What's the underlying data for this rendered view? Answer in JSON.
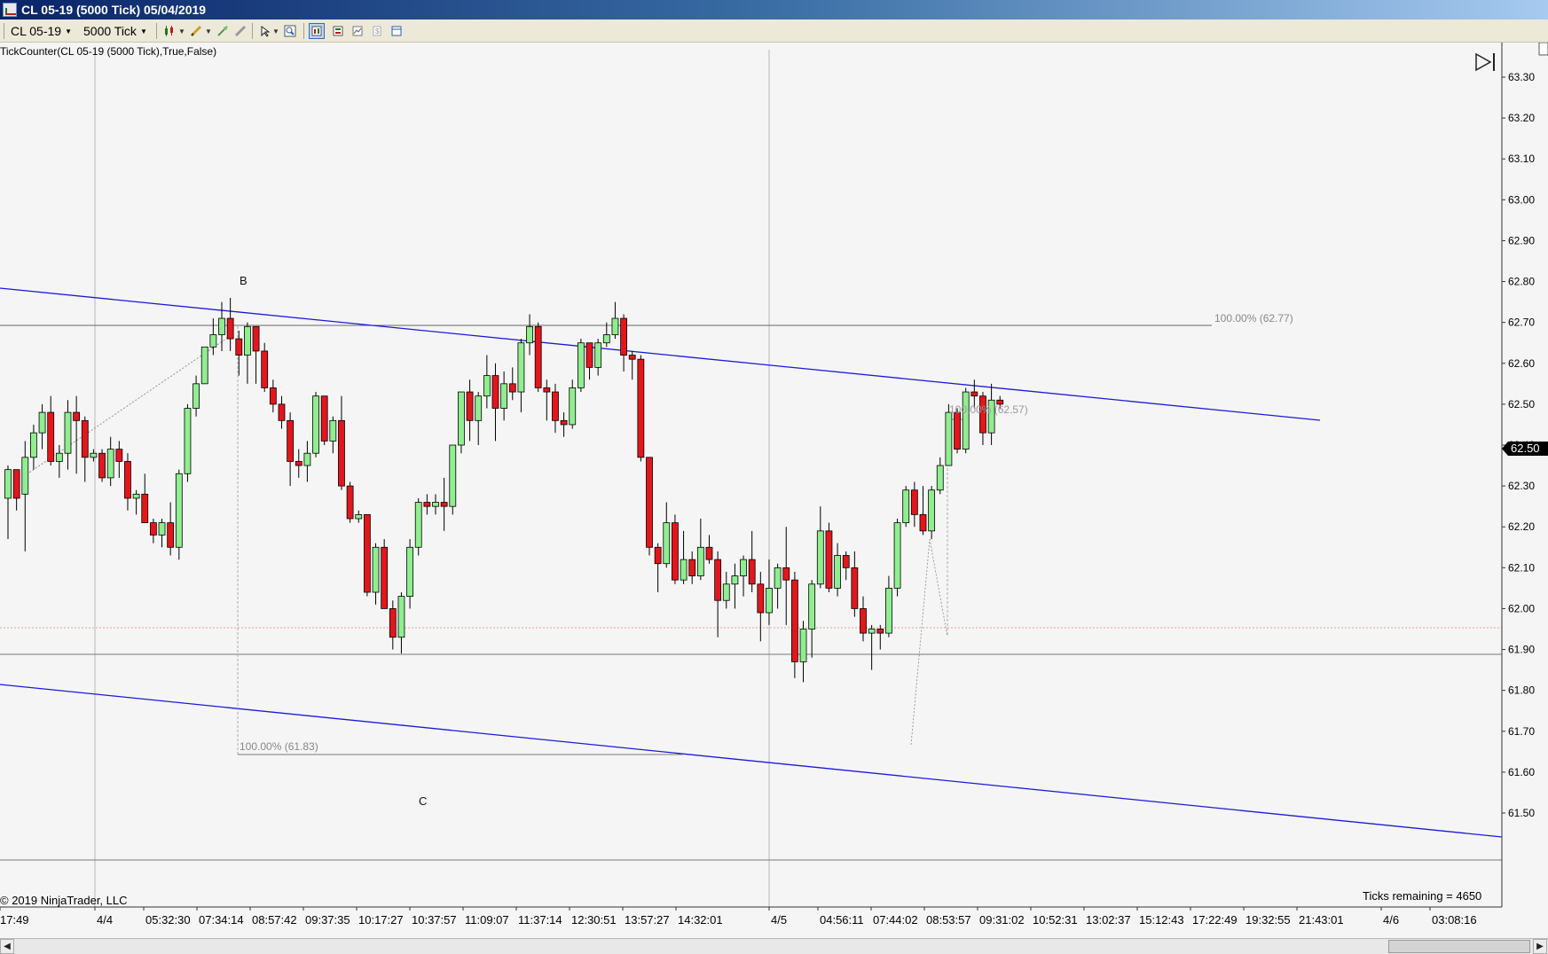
{
  "window": {
    "title": "CL 05-19 (5000 Tick)  05/04/2019"
  },
  "toolbar": {
    "instrument": "CL 05-19",
    "interval": "5000 Tick",
    "icons": [
      "candlestick-icon",
      "pencil-icon",
      "draw-tool-icon",
      "eraser-icon",
      "pointer-icon",
      "zoom-icon",
      "chart-properties-icon",
      "data-box-icon",
      "strategy-icon",
      "alert-icon",
      "window-layout-icon"
    ]
  },
  "chart": {
    "indicator_label": "TickCounter(CL 05-19 (5000 Tick),True,False)",
    "copyright": "© 2019 NinjaTrader, LLC",
    "ticks_remaining": "Ticks remaining = 4650",
    "current_price": "62.50",
    "annotations": {
      "b": "B",
      "c": "C",
      "fib_top": "100.00% (62.77)",
      "fib_mid": "100.00% (62.57)",
      "fib_bottom": "100.00% (61.83)"
    },
    "colors": {
      "up": "#90ee90",
      "down": "#e3161c",
      "channel": "#1a1adb",
      "price_marker": "#000000"
    }
  },
  "chart_data": {
    "type": "candlestick",
    "y_ticks": [
      "63.30",
      "63.20",
      "63.10",
      "63.00",
      "62.90",
      "62.80",
      "62.70",
      "62.60",
      "62.50",
      "62.40",
      "62.30",
      "62.20",
      "62.10",
      "62.00",
      "61.90",
      "61.80",
      "61.70",
      "61.60",
      "61.50"
    ],
    "x_ticks": [
      "17:49",
      "4/4",
      "05:32:30",
      "07:34:14",
      "08:57:42",
      "09:37:35",
      "10:17:27",
      "10:37:57",
      "11:09:07",
      "11:37:14",
      "12:30:51",
      "13:57:27",
      "14:32:01",
      "4/5",
      "04:56:11",
      "07:44:02",
      "08:53:57",
      "09:31:02",
      "10:52:31",
      "13:02:37",
      "15:12:43",
      "17:22:49",
      "19:32:55",
      "21:43:01",
      "4/6",
      "03:08:16"
    ],
    "ylim": [
      61.5,
      63.33
    ],
    "candles": [
      [
        62.27,
        62.34,
        62.17,
        62.35
      ],
      [
        62.34,
        62.27,
        62.28,
        62.24
      ],
      [
        62.28,
        62.37,
        62.41,
        62.14
      ],
      [
        62.37,
        62.43,
        62.45,
        62.34
      ],
      [
        62.43,
        62.48,
        62.5,
        62.39
      ],
      [
        62.48,
        62.36,
        62.52,
        62.35
      ],
      [
        62.36,
        62.38,
        62.4,
        62.32
      ],
      [
        62.38,
        62.48,
        62.51,
        62.34
      ],
      [
        62.48,
        62.46,
        62.52,
        62.33
      ],
      [
        62.46,
        62.37,
        62.47,
        62.31
      ],
      [
        62.37,
        62.38,
        62.39,
        62.36
      ],
      [
        62.38,
        62.32,
        62.39,
        62.31
      ],
      [
        62.32,
        62.39,
        62.42,
        62.3
      ],
      [
        62.39,
        62.36,
        62.41,
        62.32
      ],
      [
        62.36,
        62.27,
        62.38,
        62.24
      ],
      [
        62.27,
        62.28,
        62.29,
        62.23
      ],
      [
        62.28,
        62.21,
        62.33,
        62.21
      ],
      [
        62.21,
        62.18,
        62.22,
        62.16
      ],
      [
        62.18,
        62.21,
        62.22,
        62.15
      ],
      [
        62.21,
        62.15,
        62.26,
        62.13
      ],
      [
        62.15,
        62.33,
        62.34,
        62.12
      ],
      [
        62.33,
        62.49,
        62.5,
        62.31
      ],
      [
        62.49,
        62.55,
        62.57,
        62.47
      ],
      [
        62.55,
        62.64,
        62.64,
        62.55
      ],
      [
        62.64,
        62.67,
        62.71,
        62.62
      ],
      [
        62.67,
        62.71,
        62.75,
        62.63
      ],
      [
        62.71,
        62.66,
        62.76,
        62.63
      ],
      [
        62.66,
        62.62,
        62.68,
        62.57
      ],
      [
        62.62,
        62.69,
        62.7,
        62.55
      ],
      [
        62.69,
        62.63,
        62.68,
        62.55
      ],
      [
        62.63,
        62.54,
        62.65,
        62.53
      ],
      [
        62.54,
        62.5,
        62.56,
        62.48
      ],
      [
        62.5,
        62.46,
        62.52,
        62.44
      ],
      [
        62.46,
        62.36,
        62.48,
        62.3
      ],
      [
        62.36,
        62.35,
        62.39,
        62.32
      ],
      [
        62.35,
        62.38,
        62.41,
        62.31
      ],
      [
        62.38,
        62.52,
        62.53,
        62.37
      ],
      [
        62.52,
        62.41,
        62.52,
        62.4
      ],
      [
        62.41,
        62.46,
        62.47,
        62.38
      ],
      [
        62.46,
        62.3,
        62.52,
        62.29
      ],
      [
        62.3,
        62.22,
        62.31,
        62.21
      ],
      [
        62.22,
        62.23,
        62.24,
        62.21
      ],
      [
        62.23,
        62.04,
        62.23,
        62.03
      ],
      [
        62.04,
        62.15,
        62.16,
        62.01
      ],
      [
        62.15,
        62.0,
        62.17,
        62.0
      ],
      [
        62.0,
        61.93,
        62.02,
        61.9
      ],
      [
        61.93,
        62.03,
        62.04,
        61.89
      ],
      [
        62.03,
        62.15,
        62.17,
        62.0
      ],
      [
        62.15,
        62.26,
        62.27,
        62.13
      ],
      [
        62.26,
        62.25,
        62.28,
        62.23
      ],
      [
        62.25,
        62.26,
        62.28,
        62.23
      ],
      [
        62.26,
        62.25,
        62.32,
        62.19
      ],
      [
        62.25,
        62.4,
        62.4,
        62.23
      ],
      [
        62.4,
        62.53,
        62.53,
        62.38
      ],
      [
        62.53,
        62.46,
        62.56,
        62.41
      ],
      [
        62.46,
        62.52,
        62.53,
        62.4
      ],
      [
        62.52,
        62.57,
        62.62,
        62.49
      ],
      [
        62.57,
        62.49,
        62.6,
        62.41
      ],
      [
        62.49,
        62.55,
        62.58,
        62.46
      ],
      [
        62.55,
        62.53,
        62.59,
        62.51
      ],
      [
        62.53,
        62.65,
        62.66,
        62.48
      ],
      [
        62.65,
        62.69,
        62.72,
        62.62
      ],
      [
        62.69,
        62.54,
        62.7,
        62.53
      ],
      [
        62.54,
        62.53,
        62.56,
        62.46
      ],
      [
        62.53,
        62.46,
        62.55,
        62.43
      ],
      [
        62.46,
        62.45,
        62.48,
        62.42
      ],
      [
        62.45,
        62.54,
        62.56,
        62.44
      ],
      [
        62.54,
        62.65,
        62.66,
        62.53
      ],
      [
        62.65,
        62.59,
        62.65,
        62.56
      ],
      [
        62.59,
        62.65,
        62.66,
        62.57
      ],
      [
        62.65,
        62.67,
        62.7,
        62.64
      ],
      [
        62.67,
        62.71,
        62.75,
        62.66
      ],
      [
        62.71,
        62.62,
        62.72,
        62.58
      ],
      [
        62.62,
        62.61,
        62.63,
        62.56
      ],
      [
        62.61,
        62.37,
        62.62,
        62.36
      ],
      [
        62.37,
        62.15,
        62.37,
        62.13
      ],
      [
        62.15,
        62.11,
        62.16,
        62.04
      ],
      [
        62.11,
        62.21,
        62.26,
        62.1
      ],
      [
        62.21,
        62.07,
        62.23,
        62.06
      ],
      [
        62.07,
        62.12,
        62.19,
        62.06
      ],
      [
        62.12,
        62.08,
        62.14,
        62.06
      ],
      [
        62.08,
        62.15,
        62.22,
        62.07
      ],
      [
        62.15,
        62.12,
        62.18,
        62.11
      ],
      [
        62.12,
        62.02,
        62.14,
        61.93
      ],
      [
        62.02,
        62.06,
        62.09,
        62.0
      ],
      [
        62.06,
        62.08,
        62.11,
        62.0
      ],
      [
        62.08,
        62.12,
        62.13,
        62.03
      ],
      [
        62.12,
        62.06,
        62.19,
        62.04
      ],
      [
        62.06,
        61.99,
        62.09,
        61.92
      ],
      [
        61.99,
        62.05,
        62.12,
        61.96
      ],
      [
        62.05,
        62.1,
        62.11,
        62.0
      ],
      [
        62.1,
        62.07,
        62.2,
        61.96
      ],
      [
        62.07,
        61.87,
        62.09,
        61.83
      ],
      [
        61.87,
        61.95,
        61.97,
        61.82
      ],
      [
        61.95,
        62.06,
        62.07,
        61.88
      ],
      [
        62.06,
        62.19,
        62.25,
        62.05
      ],
      [
        62.19,
        62.05,
        62.21,
        62.04
      ],
      [
        62.05,
        62.13,
        62.16,
        62.03
      ],
      [
        62.13,
        62.1,
        62.14,
        62.07
      ],
      [
        62.1,
        62.0,
        62.14,
        61.98
      ],
      [
        62.0,
        61.94,
        62.03,
        61.92
      ],
      [
        61.94,
        61.95,
        61.96,
        61.85
      ],
      [
        61.95,
        61.94,
        61.96,
        61.9
      ],
      [
        61.94,
        62.05,
        62.08,
        61.93
      ],
      [
        62.05,
        62.21,
        62.22,
        62.03
      ],
      [
        62.21,
        62.29,
        62.3,
        62.2
      ],
      [
        62.29,
        62.23,
        62.31,
        62.2
      ],
      [
        62.23,
        62.19,
        62.3,
        62.18
      ],
      [
        62.19,
        62.29,
        62.3,
        62.17
      ],
      [
        62.29,
        62.35,
        62.37,
        62.28
      ],
      [
        62.35,
        62.48,
        62.5,
        62.35
      ],
      [
        62.48,
        62.39,
        62.49,
        62.38
      ],
      [
        62.39,
        62.53,
        62.54,
        62.38
      ],
      [
        62.53,
        62.52,
        62.56,
        62.49
      ],
      [
        62.52,
        62.43,
        62.53,
        62.4
      ],
      [
        62.43,
        62.51,
        62.55,
        62.4
      ],
      [
        62.51,
        62.5,
        62.52,
        62.49
      ]
    ]
  }
}
